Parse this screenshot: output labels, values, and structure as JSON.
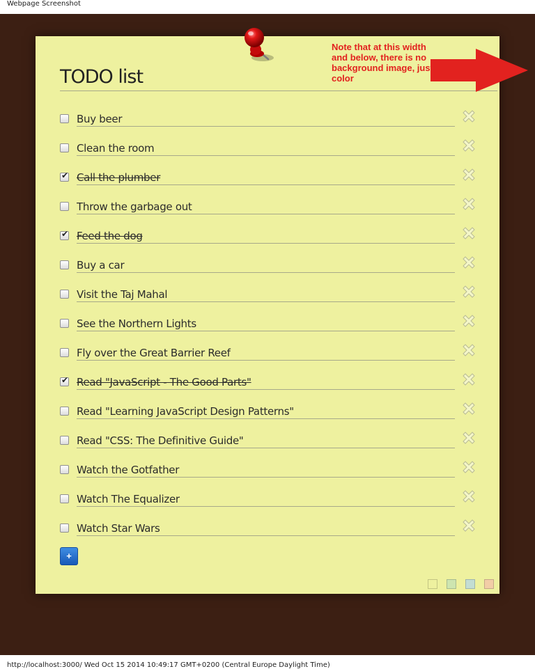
{
  "window": {
    "caption": "Webpage Screenshot",
    "footer": "http://localhost:3000/ Wed Oct 15 2014 10:49:17 GMT+0200 (Central Europe Daylight Time)"
  },
  "colors": {
    "page_background": "#3c1f13",
    "note_background": "#eef19f",
    "annotation": "#e2221f",
    "add_button": "#2a6fce"
  },
  "note": {
    "title": "TODO list",
    "annotation": "Note that at this width and below, there is no background image, just color",
    "add_label": "+",
    "pin_icon": "pushpin-icon",
    "delete_icon": "x-delete-icon"
  },
  "todos": [
    {
      "text": "Buy beer",
      "done": false
    },
    {
      "text": "Clean the room",
      "done": false
    },
    {
      "text": "Call the plumber",
      "done": true
    },
    {
      "text": "Throw the garbage out",
      "done": false
    },
    {
      "text": "Feed the dog",
      "done": true
    },
    {
      "text": "Buy a car",
      "done": false
    },
    {
      "text": "Visit the Taj Mahal",
      "done": false
    },
    {
      "text": "See the Northern Lights",
      "done": false
    },
    {
      "text": "Fly over the Great Barrier Reef",
      "done": false
    },
    {
      "text": "Read \"JavaScript - The Good Parts\"",
      "done": true
    },
    {
      "text": "Read \"Learning JavaScript Design Patterns\"",
      "done": false
    },
    {
      "text": "Read \"CSS: The Definitive Guide\"",
      "done": false
    },
    {
      "text": "Watch the Gotfather",
      "done": false
    },
    {
      "text": "Watch The Equalizer",
      "done": false
    },
    {
      "text": "Watch Star Wars",
      "done": false
    }
  ],
  "swatches": [
    "#eef19f",
    "#cde5b0",
    "#c3ddd3",
    "#f2cda6"
  ]
}
